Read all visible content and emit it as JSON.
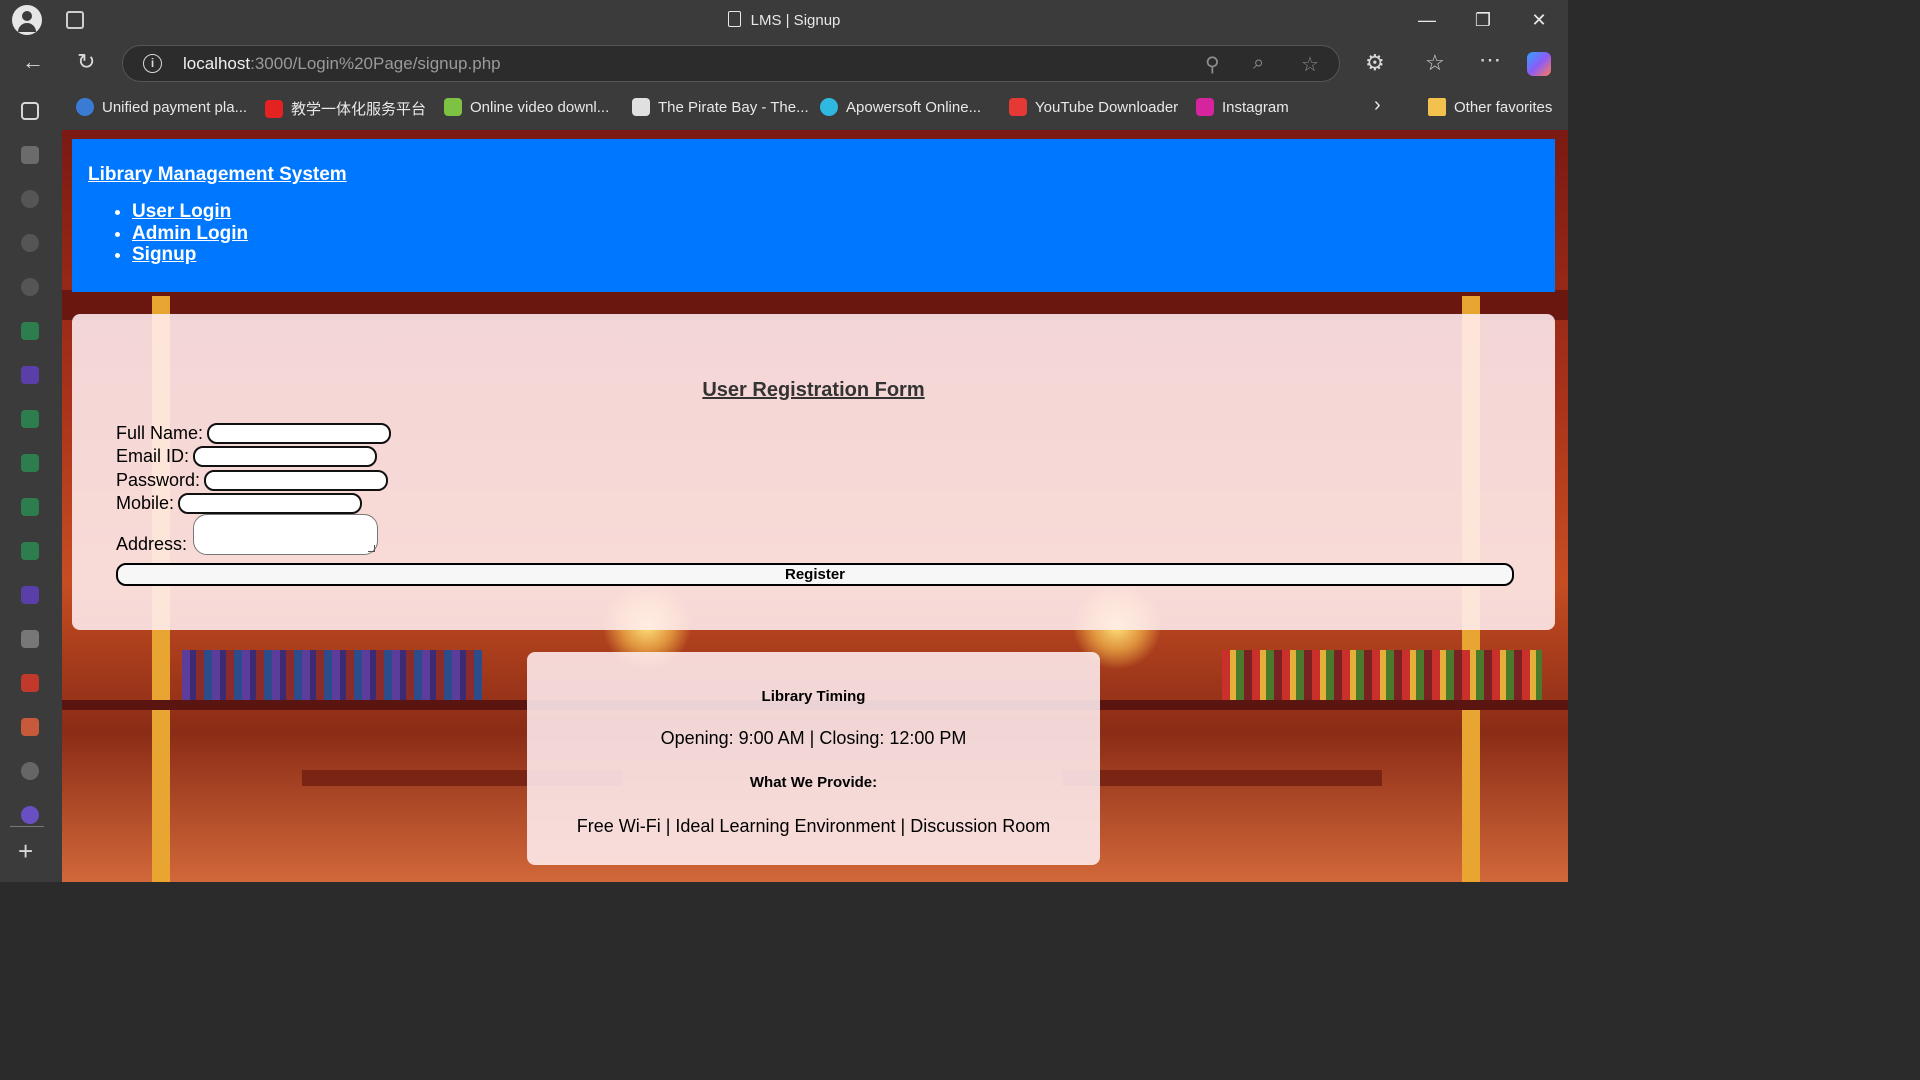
{
  "browser": {
    "tab_title": "LMS | Signup",
    "url_host": "localhost",
    "url_path": ":3000/Login%20Page/signup.php",
    "bookmarks": [
      {
        "label": "Unified payment pla...",
        "color": "#3a7bd5"
      },
      {
        "label": "教学一体化服务平台",
        "color": "#e52222"
      },
      {
        "label": "Online video downl...",
        "color": "#7dc242"
      },
      {
        "label": "The Pirate Bay - The...",
        "color": "#e0e0e0"
      },
      {
        "label": "Apowersoft Online...",
        "color": "#2fb8e0"
      },
      {
        "label": "YouTube Downloader",
        "color": "#e53935"
      },
      {
        "label": "Instagram",
        "color": "#d6249f"
      }
    ],
    "other_favorites": "Other favorites"
  },
  "header": {
    "brand": "Library Management System",
    "nav": [
      "User Login",
      "Admin Login",
      "Signup"
    ]
  },
  "form": {
    "title": "User Registration Form",
    "fields": {
      "full_name": "Full Name:",
      "email": "Email ID:",
      "password": "Password:",
      "mobile": "Mobile:",
      "address": "Address:"
    },
    "submit": "Register"
  },
  "info": {
    "timing_heading": "Library Timing",
    "timing_text": "Opening: 9:00 AM | Closing: 12:00 PM",
    "provide_heading": "What We Provide:",
    "provide_text": "Free Wi-Fi | Ideal Learning Environment | Discussion Room"
  }
}
